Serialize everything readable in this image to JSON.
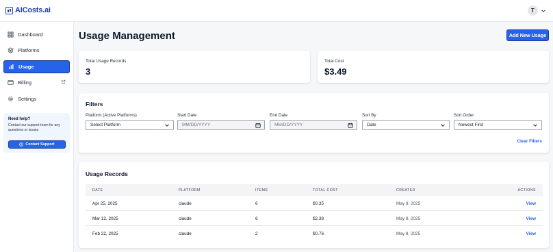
{
  "app": {
    "name": "AICosts.ai",
    "user_initial": "T"
  },
  "sidebar": {
    "items": [
      {
        "label": "Dashboard",
        "icon": "grid-icon"
      },
      {
        "label": "Platforms",
        "icon": "layers-icon"
      },
      {
        "label": "Usage",
        "icon": "bar-chart-icon",
        "active": true
      },
      {
        "label": "Billing",
        "icon": "credit-card-icon",
        "external": true
      },
      {
        "label": "Settings",
        "icon": "gear-icon"
      }
    ],
    "help": {
      "title": "Need help?",
      "text": "Contact our support team for any questions or issues",
      "button": "Contact Support"
    }
  },
  "header": {
    "title": "Usage Management",
    "add_button": "Add New Usage"
  },
  "stats": [
    {
      "label": "Total Usage Records",
      "value": "3"
    },
    {
      "label": "Total Cost",
      "value": "$3.49"
    }
  ],
  "filters": {
    "title": "Filters",
    "platform": {
      "label": "Platform (Active Platforms)",
      "value": "Select Platform"
    },
    "start_date": {
      "label": "Start Date",
      "placeholder": "MM/DD/YYYY"
    },
    "end_date": {
      "label": "End Date",
      "placeholder": "MM/DD/YYYY"
    },
    "sort_by": {
      "label": "Sort By",
      "value": "Date"
    },
    "sort_order": {
      "label": "Sort Order",
      "value": "Newest First"
    },
    "clear": "Clear Filters"
  },
  "records": {
    "title": "Usage Records",
    "columns": [
      "DATE",
      "PLATFORM",
      "ITEMS",
      "TOTAL COST",
      "CREATED",
      "ACTIONS"
    ],
    "rows": [
      {
        "date": "Apr 25, 2025",
        "platform": "claude",
        "items": "6",
        "total_cost": "$0.35",
        "created": "May 8, 2025",
        "action": "View"
      },
      {
        "date": "Mar 12, 2025",
        "platform": "claude",
        "items": "6",
        "total_cost": "$2.38",
        "created": "May 8, 2025",
        "action": "View"
      },
      {
        "date": "Feb 22, 2025",
        "platform": "claude",
        "items": "2",
        "total_cost": "$0.76",
        "created": "May 8, 2025",
        "action": "View"
      }
    ]
  },
  "colors": {
    "accent": "#2563eb",
    "brand": "#1e40af",
    "background": "#f6f7f9"
  }
}
